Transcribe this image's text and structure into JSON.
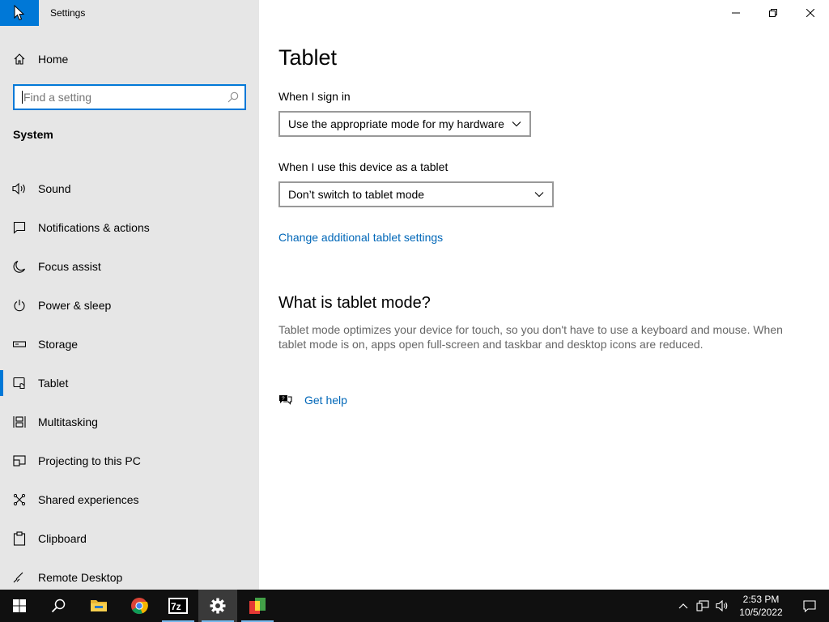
{
  "window": {
    "app_title": "Settings",
    "controls": [
      "minimize-icon",
      "restore-icon",
      "close-icon"
    ]
  },
  "sidebar": {
    "home_label": "Home",
    "search_placeholder": "Find a setting",
    "section_label": "System",
    "items": [
      {
        "label": "Sound",
        "icon": "speaker-icon"
      },
      {
        "label": "Notifications & actions",
        "icon": "notification-icon"
      },
      {
        "label": "Focus assist",
        "icon": "moon-icon"
      },
      {
        "label": "Power & sleep",
        "icon": "power-icon"
      },
      {
        "label": "Storage",
        "icon": "storage-icon"
      },
      {
        "label": "Tablet",
        "icon": "tablet-icon",
        "active": true
      },
      {
        "label": "Multitasking",
        "icon": "multitasking-icon"
      },
      {
        "label": "Projecting to this PC",
        "icon": "projecting-icon"
      },
      {
        "label": "Shared experiences",
        "icon": "shared-experiences-icon"
      },
      {
        "label": "Clipboard",
        "icon": "clipboard-icon"
      },
      {
        "label": "Remote Desktop",
        "icon": "remote-desktop-icon"
      }
    ]
  },
  "main": {
    "title": "Tablet",
    "sign_in_label": "When I sign in",
    "sign_in_value": "Use the appropriate mode for my hardware",
    "tablet_use_label": "When I use this device as a tablet",
    "tablet_use_value": "Don’t switch to tablet mode",
    "additional_link": "Change additional tablet settings",
    "what_is_title": "What is tablet mode?",
    "what_is_desc": "Tablet mode optimizes your device for touch, so you don't have to use a keyboard and mouse. When tablet mode is on, apps open full-screen and taskbar and desktop icons are reduced.",
    "help_link": "Get help"
  },
  "taskbar": {
    "apps": [
      "start-icon",
      "search-icon",
      "file-explorer-icon",
      "chrome-icon",
      "7zip-icon",
      "settings-icon",
      "app-icon"
    ],
    "clock_time": "2:53 PM",
    "clock_date": "10/5/2022"
  },
  "colors": {
    "accent": "#0078d7",
    "link": "#0067b8",
    "sidebar_bg": "#e6e6e6",
    "taskbar_bg": "#101010"
  }
}
